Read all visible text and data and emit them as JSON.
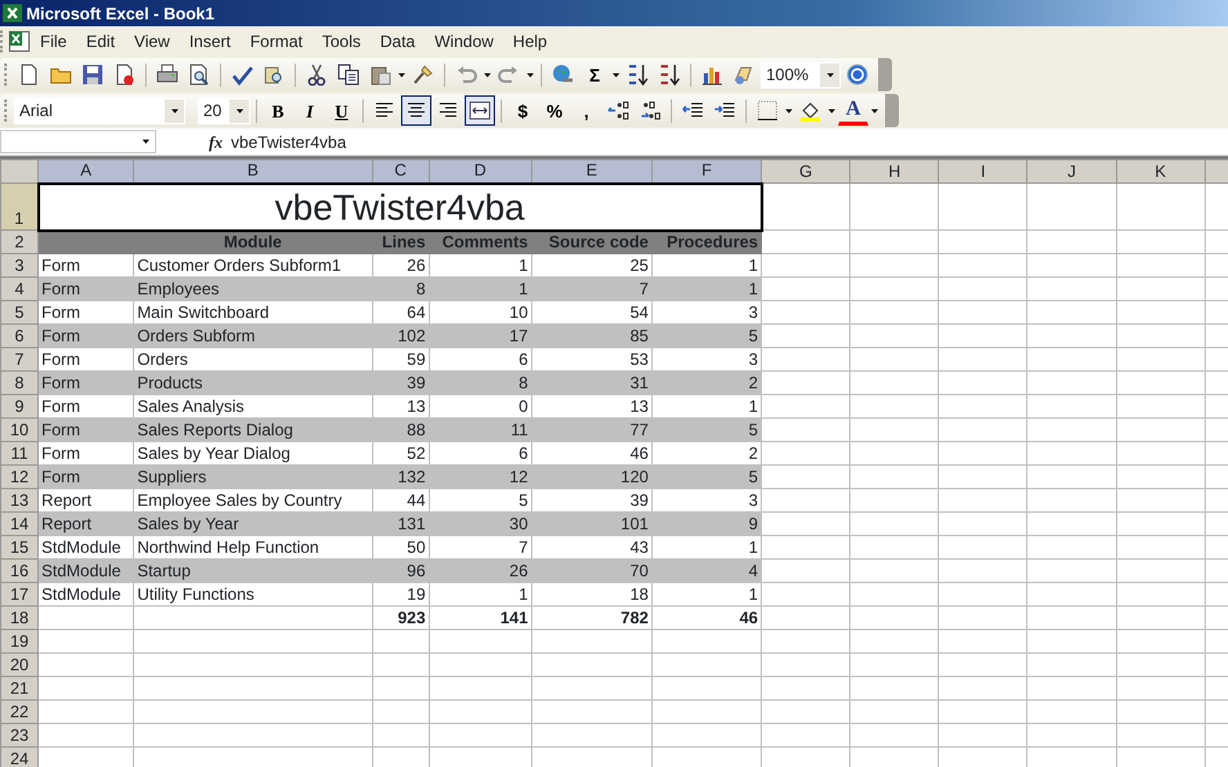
{
  "window": {
    "title": "Microsoft Excel - Book1"
  },
  "menu": [
    "File",
    "Edit",
    "View",
    "Insert",
    "Format",
    "Tools",
    "Data",
    "Window",
    "Help"
  ],
  "standard_toolbar": {
    "sum_label": "Σ",
    "zoom": "100%"
  },
  "formatting_toolbar": {
    "font": "Arial",
    "size": "20",
    "bold_label": "B",
    "italic_label": "I",
    "underline_label": "U",
    "align_buttons": [
      {
        "pressed": false
      },
      {
        "pressed": true
      },
      {
        "pressed": false
      }
    ],
    "merge_center": {
      "pressed": true
    },
    "currency_label": "$",
    "percent_label": "%",
    "comma_label": ",",
    "font_color_label": "A"
  },
  "formula_bar": {
    "fx_label": "fx",
    "value": "vbeTwister4vba"
  },
  "sheet": {
    "columns": [
      {
        "label": "A",
        "selected": true
      },
      {
        "label": "B",
        "selected": true
      },
      {
        "label": "C",
        "selected": true
      },
      {
        "label": "D",
        "selected": true
      },
      {
        "label": "E",
        "selected": true
      },
      {
        "label": "F",
        "selected": true
      },
      {
        "label": "G",
        "selected": false
      },
      {
        "label": "H",
        "selected": false
      },
      {
        "label": "I",
        "selected": false
      },
      {
        "label": "J",
        "selected": false
      },
      {
        "label": "K",
        "selected": false
      }
    ],
    "rows": [
      {
        "number": "1",
        "selected": true,
        "kind": "title",
        "cells": [
          "vbeTwister4vba"
        ]
      },
      {
        "number": "2",
        "selected": false,
        "kind": "header",
        "cells": [
          "Module",
          "Lines",
          "Comments",
          "Source code",
          "Procedures"
        ]
      },
      {
        "number": "3",
        "selected": false,
        "kind": "data",
        "shaded": false,
        "cells": [
          "Form",
          "Customer Orders Subform1",
          "26",
          "1",
          "25",
          "1"
        ]
      },
      {
        "number": "4",
        "selected": false,
        "kind": "data",
        "shaded": true,
        "cells": [
          "Form",
          "Employees",
          "8",
          "1",
          "7",
          "1"
        ]
      },
      {
        "number": "5",
        "selected": false,
        "kind": "data",
        "shaded": false,
        "cells": [
          "Form",
          "Main Switchboard",
          "64",
          "10",
          "54",
          "3"
        ]
      },
      {
        "number": "6",
        "selected": false,
        "kind": "data",
        "shaded": true,
        "cells": [
          "Form",
          "Orders Subform",
          "102",
          "17",
          "85",
          "5"
        ]
      },
      {
        "number": "7",
        "selected": false,
        "kind": "data",
        "shaded": false,
        "cells": [
          "Form",
          "Orders",
          "59",
          "6",
          "53",
          "3"
        ]
      },
      {
        "number": "8",
        "selected": false,
        "kind": "data",
        "shaded": true,
        "cells": [
          "Form",
          "Products",
          "39",
          "8",
          "31",
          "2"
        ]
      },
      {
        "number": "9",
        "selected": false,
        "kind": "data",
        "shaded": false,
        "cells": [
          "Form",
          "Sales Analysis",
          "13",
          "0",
          "13",
          "1"
        ]
      },
      {
        "number": "10",
        "selected": false,
        "kind": "data",
        "shaded": true,
        "cells": [
          "Form",
          "Sales Reports Dialog",
          "88",
          "11",
          "77",
          "5"
        ]
      },
      {
        "number": "11",
        "selected": false,
        "kind": "data",
        "shaded": false,
        "cells": [
          "Form",
          "Sales by Year Dialog",
          "52",
          "6",
          "46",
          "2"
        ]
      },
      {
        "number": "12",
        "selected": false,
        "kind": "data",
        "shaded": true,
        "cells": [
          "Form",
          "Suppliers",
          "132",
          "12",
          "120",
          "5"
        ]
      },
      {
        "number": "13",
        "selected": false,
        "kind": "data",
        "shaded": false,
        "cells": [
          "Report",
          "Employee Sales by Country",
          "44",
          "5",
          "39",
          "3"
        ]
      },
      {
        "number": "14",
        "selected": false,
        "kind": "data",
        "shaded": true,
        "cells": [
          "Report",
          "Sales by Year",
          "131",
          "30",
          "101",
          "9"
        ]
      },
      {
        "number": "15",
        "selected": false,
        "kind": "data",
        "shaded": false,
        "cells": [
          "StdModule",
          "Northwind Help Function",
          "50",
          "7",
          "43",
          "1"
        ]
      },
      {
        "number": "16",
        "selected": false,
        "kind": "data",
        "shaded": true,
        "cells": [
          "StdModule",
          "Startup",
          "96",
          "26",
          "70",
          "4"
        ]
      },
      {
        "number": "17",
        "selected": false,
        "kind": "data",
        "shaded": false,
        "cells": [
          "StdModule",
          "Utility Functions",
          "19",
          "1",
          "18",
          "1"
        ]
      },
      {
        "number": "18",
        "selected": false,
        "kind": "total",
        "cells": [
          "923",
          "141",
          "782",
          "46"
        ]
      },
      {
        "number": "19",
        "selected": false,
        "kind": "empty"
      },
      {
        "number": "20",
        "selected": false,
        "kind": "empty"
      },
      {
        "number": "21",
        "selected": false,
        "kind": "empty"
      },
      {
        "number": "22",
        "selected": false,
        "kind": "empty"
      },
      {
        "number": "23",
        "selected": false,
        "kind": "empty"
      },
      {
        "number": "24",
        "selected": false,
        "kind": "empty"
      }
    ]
  }
}
